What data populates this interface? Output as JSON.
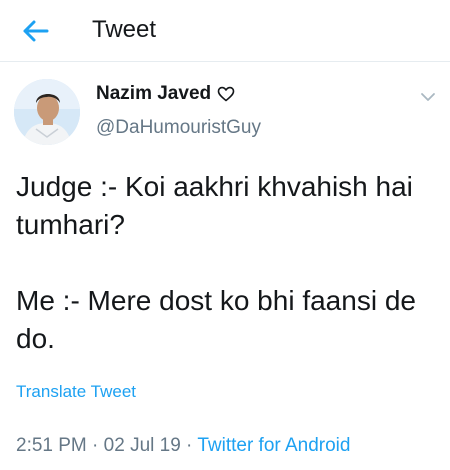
{
  "header": {
    "title": "Tweet"
  },
  "tweet": {
    "author_name": "Nazim Javed",
    "handle": "@DaHumouristGuy",
    "text_line1": "Judge :- Koi aakhri khvahish hai tumhari?",
    "text_line2": "Me :- Mere dost ko bhi faansi de do.",
    "translate_label": "Translate Tweet",
    "time": "2:51 PM",
    "date": "02 Jul 19",
    "separator": " · ",
    "source": "Twitter for Android"
  },
  "colors": {
    "accent": "#1da1f2",
    "secondary_text": "#657786",
    "primary_text": "#14171a"
  },
  "icons": {
    "back": "arrow-left-icon",
    "heart": "heart-outline-icon",
    "more": "chevron-down-icon"
  }
}
